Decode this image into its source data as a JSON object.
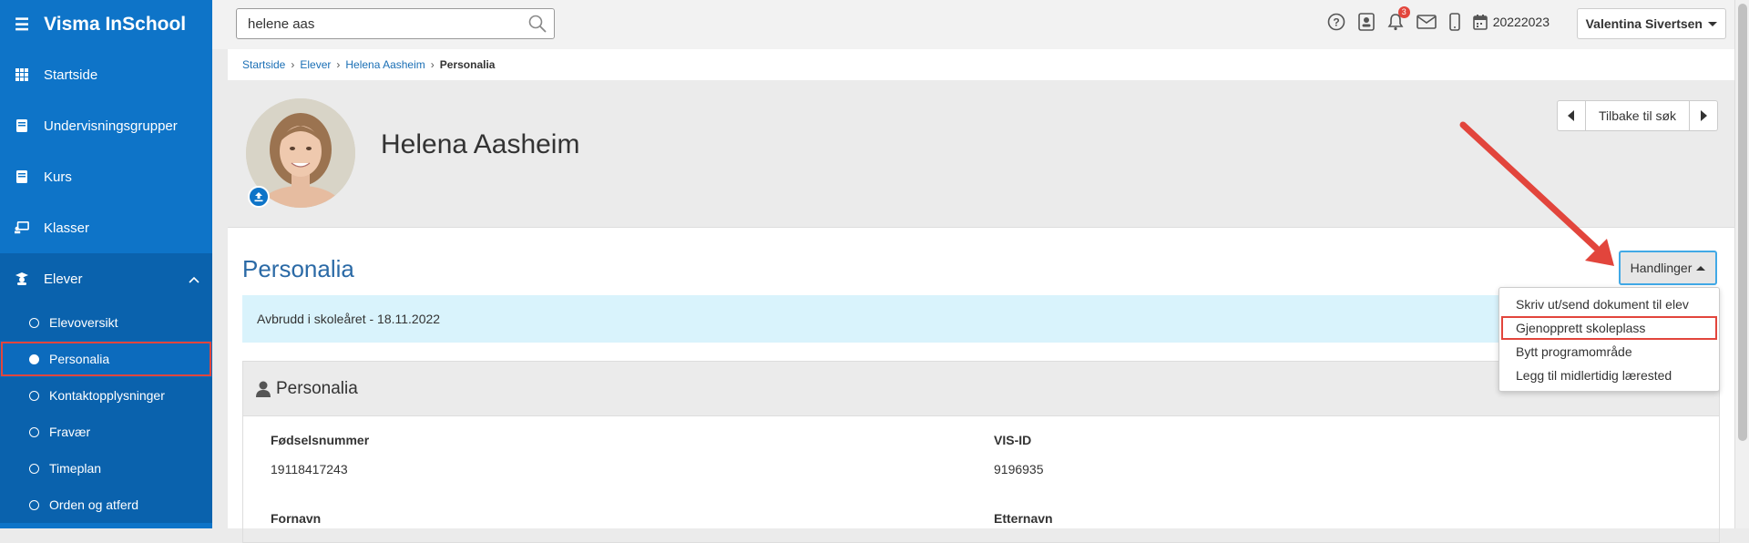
{
  "app": {
    "title": "Visma InSchool"
  },
  "sidebar": {
    "items": [
      {
        "label": "Startside",
        "icon": "grid-icon"
      },
      {
        "label": "Undervisningsgrupper",
        "icon": "book-icon"
      },
      {
        "label": "Kurs",
        "icon": "book-icon"
      },
      {
        "label": "Klasser",
        "icon": "classroom-icon"
      },
      {
        "label": "Elever",
        "icon": "student-icon",
        "expanded": true
      }
    ],
    "subitems": [
      {
        "label": "Elevoversikt"
      },
      {
        "label": "Personalia",
        "active": true
      },
      {
        "label": "Kontaktopplysninger"
      },
      {
        "label": "Fravær"
      },
      {
        "label": "Timeplan"
      },
      {
        "label": "Orden og atferd"
      }
    ]
  },
  "topbar": {
    "search_value": "helene aas",
    "notifications_count": "3",
    "term": "20222023",
    "user": "Valentina Sivertsen"
  },
  "breadcrumb": {
    "items": [
      "Startside",
      "Elever",
      "Helena Aasheim"
    ],
    "current": "Personalia"
  },
  "student": {
    "name": "Helena Aasheim"
  },
  "pager": {
    "label": "Tilbake til søk"
  },
  "page": {
    "title": "Personalia",
    "actions_label": "Handlinger",
    "alert": "Avbrudd i skoleåret - 18.11.2022"
  },
  "actions_menu": [
    "Skriv ut/send dokument til elev",
    "Gjenopprett skoleplass",
    "Bytt programområde",
    "Legg til midlertidig lærested"
  ],
  "panel": {
    "title": "Personalia",
    "fields": [
      {
        "label": "Fødselsnummer",
        "value": "19118417243"
      },
      {
        "label": "VIS-ID",
        "value": "9196935"
      },
      {
        "label": "Fornavn",
        "value": ""
      },
      {
        "label": "Etternavn",
        "value": ""
      }
    ]
  },
  "colors": {
    "sidebar": "#0e74c8",
    "sidebar_active": "#0a62ad",
    "link": "#1a6fb5",
    "highlight": "#e2453c",
    "alert_bg": "#d9f3fc"
  }
}
